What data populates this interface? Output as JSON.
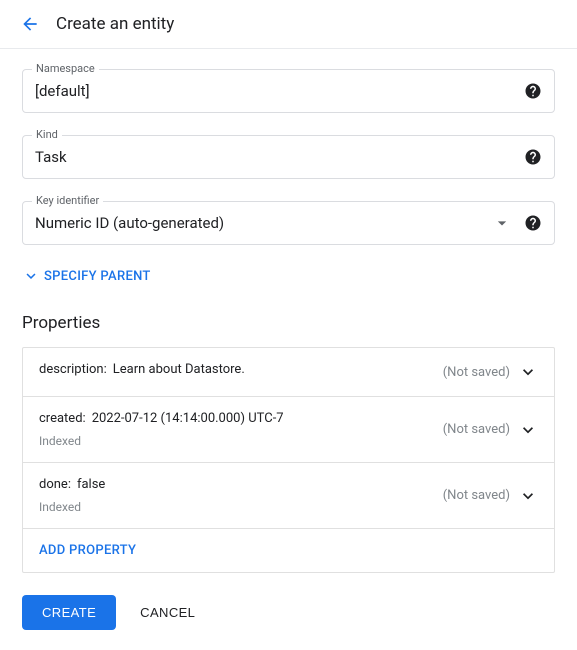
{
  "header": {
    "title": "Create an entity"
  },
  "fields": {
    "namespace": {
      "label": "Namespace",
      "value": "[default]"
    },
    "kind": {
      "label": "Kind",
      "value": "Task"
    },
    "key": {
      "label": "Key identifier",
      "value": "Numeric ID (auto-generated)"
    }
  },
  "specify_parent": "SPECIFY PARENT",
  "properties": {
    "heading": "Properties",
    "not_saved": "(Not saved)",
    "indexed": "Indexed",
    "add": "ADD PROPERTY",
    "items": [
      {
        "name": "description:",
        "value": "Learn about Datastore.",
        "indexed": false
      },
      {
        "name": "created:",
        "value": "2022-07-12 (14:14:00.000) UTC-7",
        "indexed": true
      },
      {
        "name": "done:",
        "value": "false",
        "indexed": true
      }
    ]
  },
  "actions": {
    "create": "CREATE",
    "cancel": "CANCEL"
  }
}
